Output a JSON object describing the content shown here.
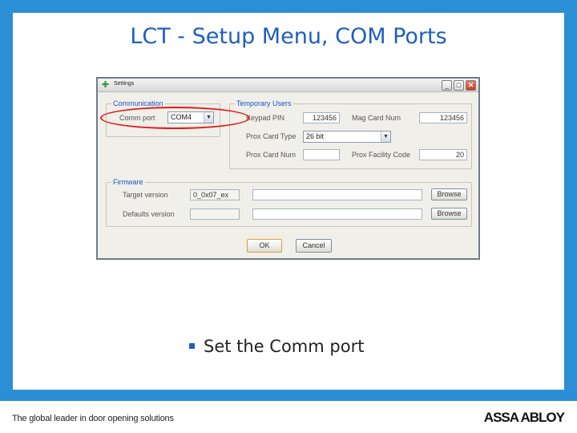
{
  "slide": {
    "title": "LCT - Setup Menu, COM Ports",
    "bullet": "Set the Comm port"
  },
  "window": {
    "title": "Settings",
    "controls": {
      "minimize": "_",
      "maximize": "□",
      "close": "✕"
    }
  },
  "communication": {
    "legend": "Communication",
    "comm_port_label": "Comm port",
    "comm_port_value": "COM4"
  },
  "temporary_users": {
    "legend": "Temporary Users",
    "keypad_pin_label": "Keypad PIN",
    "keypad_pin_value": "123456",
    "mag_card_label": "Mag Card Num",
    "mag_card_value": "123456",
    "prox_card_type_label": "Prox Card Type",
    "prox_card_type_value": "26 bit",
    "prox_card_num_label": "Prox Card Num",
    "prox_card_num_value": "",
    "prox_facility_label": "Prox Facility Code",
    "prox_facility_value": "20"
  },
  "firmware": {
    "legend": "Firmware",
    "target_version_label": "Target version",
    "target_version_value": "0_0x07_ex",
    "target_path": "",
    "browse_label": "Browse",
    "defaults_version_label": "Defaults version",
    "defaults_version_value": "",
    "defaults_path": ""
  },
  "buttons": {
    "ok": "OK",
    "cancel": "Cancel"
  },
  "footer": {
    "tagline": "The global leader in door opening solutions",
    "brand": "ASSA ABLOY"
  },
  "colors": {
    "frame": "#2a8fd4",
    "title": "#1f5fbf",
    "highlight": "#e11919",
    "group_label": "#1c53c8"
  }
}
